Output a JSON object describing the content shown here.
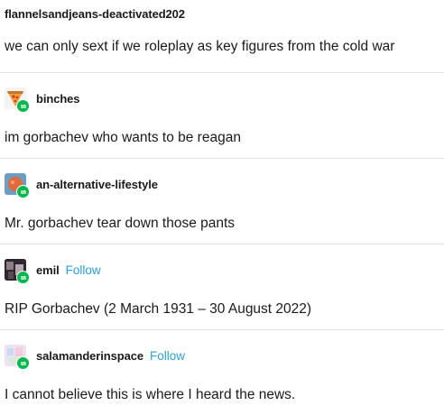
{
  "posts": [
    {
      "username": "flannelsandjeans-deactivated202",
      "text": "we can only sext if we roleplay as key figures from the cold war"
    },
    {
      "username": "binches",
      "avatar_icon": "pizza-slice-icon",
      "text": "im gorbachev who wants to be reagan"
    },
    {
      "username": "an-alternative-lifestyle",
      "avatar_icon": "orange-circle-icon",
      "text": "Mr. gorbachev tear down those pants"
    },
    {
      "username": "emil",
      "follow_label": "Follow",
      "avatar_icon": "photo-avatar-icon",
      "text": "RIP Gorbachev (2 March 1931 – 30 August 2022)"
    },
    {
      "username": "salamanderinspace",
      "follow_label": "Follow",
      "avatar_icon": "pastel-avatar-icon",
      "text": "I cannot believe this is where I heard the news."
    }
  ],
  "colors": {
    "follow": "#2aa1d9",
    "reblog_badge": "#00b84d",
    "divider": "#e2e2e2",
    "text": "#1a1a1a"
  }
}
